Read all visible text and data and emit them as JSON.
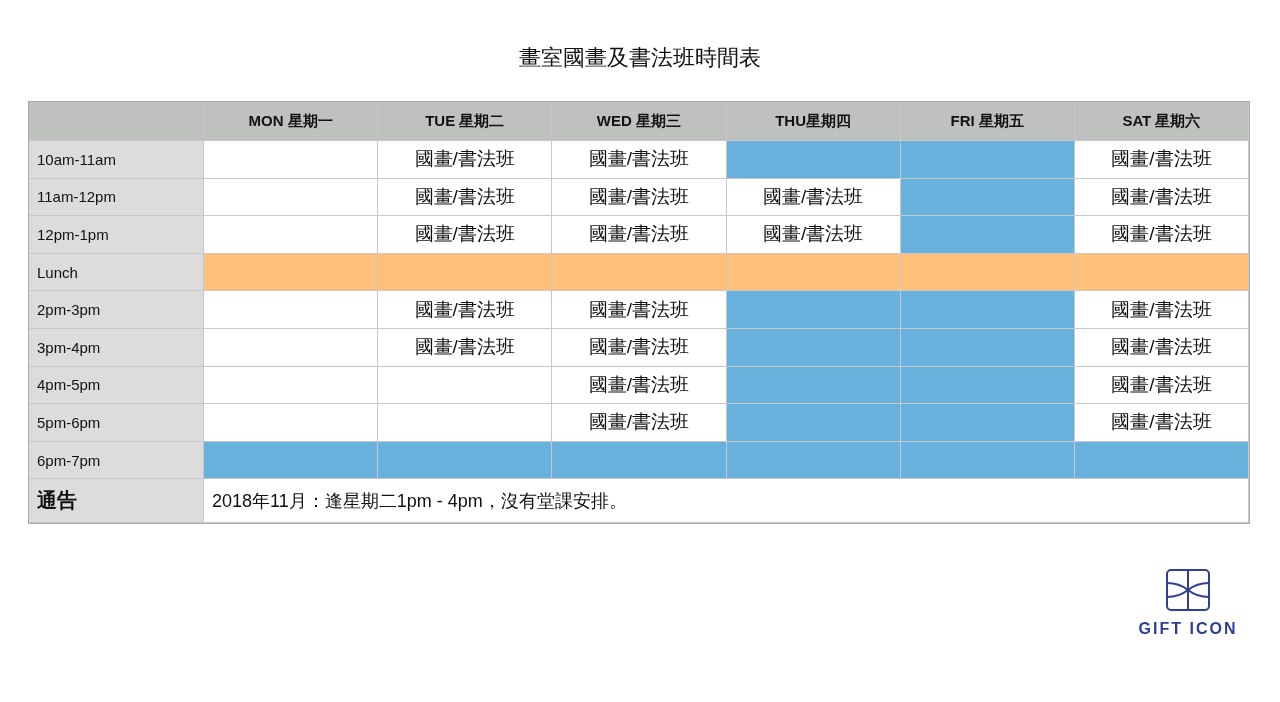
{
  "title": "畫室國畫及書法班時間表",
  "columns": [
    "MON 星期一",
    "TUE 星期二",
    "WED 星期三",
    "THU星期四",
    "FRI 星期五",
    "SAT 星期六"
  ],
  "rows": [
    {
      "time": "10am-11am",
      "cells": [
        {
          "kind": "empty"
        },
        {
          "kind": "class",
          "text": "國畫/書法班"
        },
        {
          "kind": "class",
          "text": "國畫/書法班"
        },
        {
          "kind": "blocked"
        },
        {
          "kind": "blocked"
        },
        {
          "kind": "class",
          "text": "國畫/書法班"
        }
      ]
    },
    {
      "time": "11am-12pm",
      "cells": [
        {
          "kind": "empty"
        },
        {
          "kind": "class",
          "text": "國畫/書法班"
        },
        {
          "kind": "class",
          "text": "國畫/書法班"
        },
        {
          "kind": "class",
          "text": "國畫/書法班"
        },
        {
          "kind": "blocked"
        },
        {
          "kind": "class",
          "text": "國畫/書法班"
        }
      ]
    },
    {
      "time": "12pm-1pm",
      "cells": [
        {
          "kind": "empty"
        },
        {
          "kind": "class",
          "text": "國畫/書法班"
        },
        {
          "kind": "class",
          "text": "國畫/書法班"
        },
        {
          "kind": "class",
          "text": "國畫/書法班"
        },
        {
          "kind": "blocked"
        },
        {
          "kind": "class",
          "text": "國畫/書法班"
        }
      ]
    },
    {
      "time": "Lunch",
      "cells": [
        {
          "kind": "lunch"
        },
        {
          "kind": "lunch"
        },
        {
          "kind": "lunch"
        },
        {
          "kind": "lunch"
        },
        {
          "kind": "lunch"
        },
        {
          "kind": "lunch"
        }
      ]
    },
    {
      "time": "2pm-3pm",
      "cells": [
        {
          "kind": "empty"
        },
        {
          "kind": "class",
          "text": "國畫/書法班"
        },
        {
          "kind": "class",
          "text": "國畫/書法班"
        },
        {
          "kind": "blocked"
        },
        {
          "kind": "blocked"
        },
        {
          "kind": "class",
          "text": "國畫/書法班"
        }
      ]
    },
    {
      "time": "3pm-4pm",
      "cells": [
        {
          "kind": "empty"
        },
        {
          "kind": "class",
          "text": "國畫/書法班"
        },
        {
          "kind": "class",
          "text": "國畫/書法班"
        },
        {
          "kind": "blocked"
        },
        {
          "kind": "blocked"
        },
        {
          "kind": "class",
          "text": "國畫/書法班"
        }
      ]
    },
    {
      "time": "4pm-5pm",
      "cells": [
        {
          "kind": "empty"
        },
        {
          "kind": "empty"
        },
        {
          "kind": "class",
          "text": "國畫/書法班"
        },
        {
          "kind": "blocked"
        },
        {
          "kind": "blocked"
        },
        {
          "kind": "class",
          "text": "國畫/書法班"
        }
      ]
    },
    {
      "time": "5pm-6pm",
      "cells": [
        {
          "kind": "empty"
        },
        {
          "kind": "empty"
        },
        {
          "kind": "class",
          "text": "國畫/書法班"
        },
        {
          "kind": "blocked"
        },
        {
          "kind": "blocked"
        },
        {
          "kind": "class",
          "text": "國畫/書法班"
        }
      ]
    },
    {
      "time": "6pm-7pm",
      "cells": [
        {
          "kind": "blocked"
        },
        {
          "kind": "blocked"
        },
        {
          "kind": "blocked"
        },
        {
          "kind": "blocked"
        },
        {
          "kind": "blocked"
        },
        {
          "kind": "blocked"
        }
      ]
    }
  ],
  "notice": {
    "label": "通告",
    "text": "2018年11月：逢星期二1pm - 4pm，沒有堂課安排。"
  },
  "logo": {
    "text": "GIFT ICON"
  }
}
